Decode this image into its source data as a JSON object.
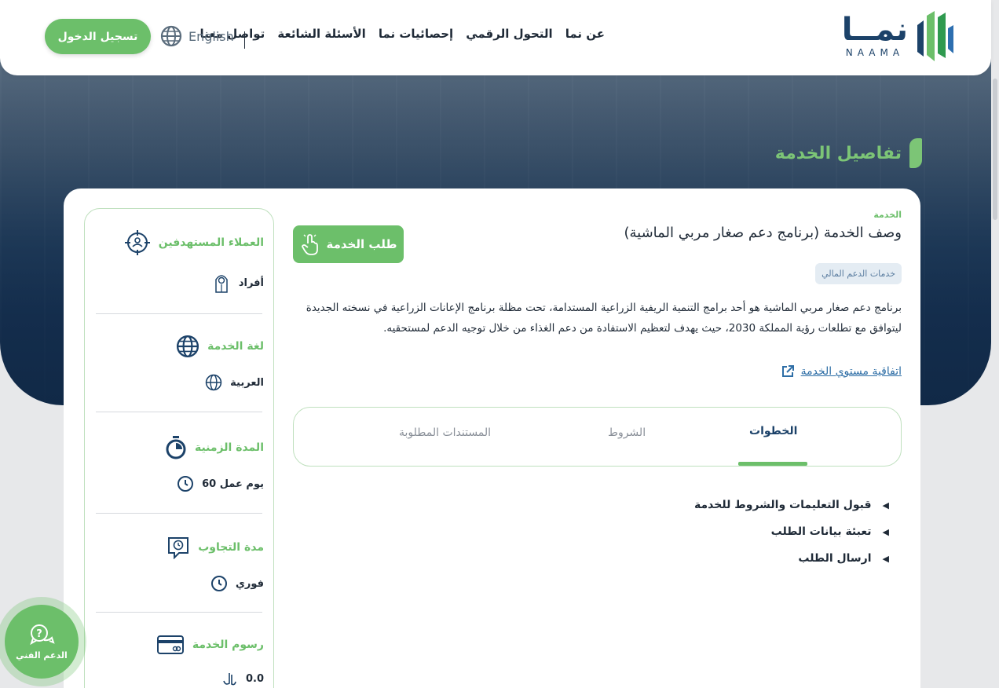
{
  "header": {
    "logo_ar": "نمــا",
    "logo_en": "NAAMA",
    "nav": [
      "عن نما",
      "التحول الرقمي",
      "إحصائيات نما",
      "الأسئلة الشائعة",
      "تواصل معنا"
    ],
    "language": "English",
    "login": "تسجيل الدخول"
  },
  "hero": {
    "title": "تفاصيل الخدمة"
  },
  "service": {
    "label": "الخدمة",
    "title": "وصف الخدمة (برنامج دعم صغار مربي الماشية)",
    "request_button": "طلب الخدمة",
    "category": "خدمات الدعم المالي",
    "description": "برنامج دعم صغار مربي الماشية هو أحد برامج التنمية الريفية الزراعية المستدامة، تحت مظلة برنامج الإعانات الزراعية في نسخته الجديدة ليتوافق مع تطلعات رؤية المملكة 2030، حيث يهدف لتعظيم الاستفادة من دعم الغذاء من خلال توجيه الدعم لمستحقيه.",
    "sla_link": "اتفاقية مستوي الخدمة"
  },
  "tabs": [
    "الخطوات",
    "الشروط",
    "المستندات المطلوبة"
  ],
  "steps": [
    "قبول التعليمات والشروط للخدمة",
    "تعبئة بيانات الطلب",
    "ارسال الطلب"
  ],
  "sidebar": {
    "audience_title": "العملاء المستهدفين",
    "audience_value": "أفراد",
    "language_title": "لغة الخدمة",
    "language_value": "العربية",
    "duration_title": "المدة الزمنية",
    "duration_value": "60 يوم عمل",
    "response_title": "مدة التجاوب",
    "response_value": "فوري",
    "fees_title": "رسوم الخدمة",
    "fees_value": "0.0"
  },
  "support": {
    "label": "الدعم الفني"
  },
  "colors": {
    "accent": "#6cbf6a",
    "brand": "#1c4269",
    "link": "#2e6ea6"
  }
}
